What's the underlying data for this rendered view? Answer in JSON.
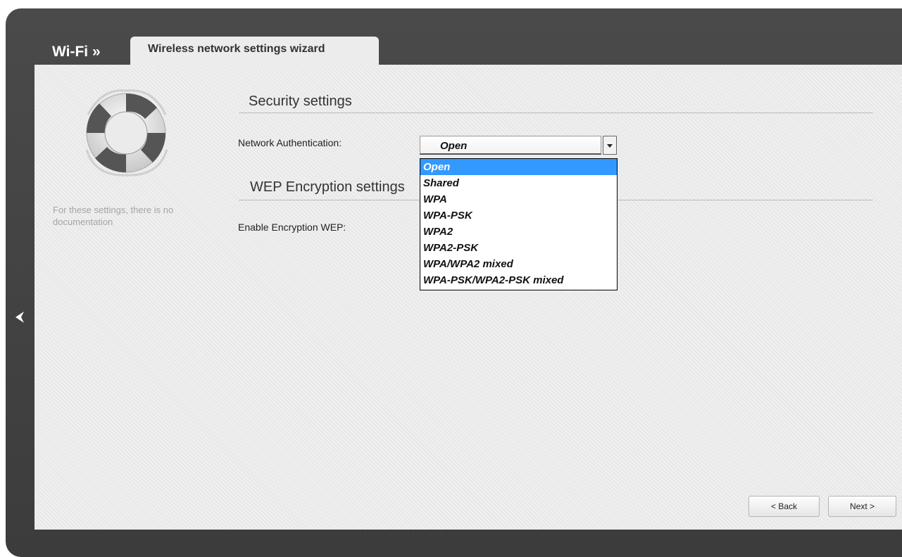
{
  "header": {
    "section": "Wi-Fi »",
    "tab": "Wireless network settings wizard"
  },
  "sidebar": {
    "icon": "lifebuoy-icon",
    "doc_note": "For these settings, there is no documentation"
  },
  "security": {
    "heading": "Security settings",
    "auth_label": "Network Authentication:",
    "auth_value": "Open",
    "options": [
      "Open",
      "Shared",
      "WPA",
      "WPA-PSK",
      "WPA2",
      "WPA2-PSK",
      "WPA/WPA2 mixed",
      "WPA-PSK/WPA2-PSK mixed"
    ],
    "selected_option": "Open"
  },
  "wep": {
    "heading": "WEP Encryption settings",
    "enable_label": "Enable Encryption WEP:"
  },
  "buttons": {
    "back": "< Back",
    "next": "Next >"
  },
  "colors": {
    "frame": "#444444",
    "panel": "#ebebeb",
    "selection": "#3399ff"
  }
}
